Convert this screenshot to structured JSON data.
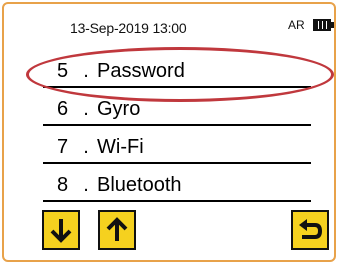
{
  "status": {
    "datetime": "13-Sep-2019  13:00",
    "mode_label": "AR",
    "battery_icon": "battery-icon"
  },
  "menu": {
    "items": [
      {
        "number": "5",
        "label": "Password",
        "highlighted": true
      },
      {
        "number": "6",
        "label": "Gyro"
      },
      {
        "number": "7",
        "label": "Wi-Fi"
      },
      {
        "number": "8",
        "label": "Bluetooth"
      }
    ],
    "separator": "."
  },
  "buttons": {
    "down": {
      "icon": "arrow-down-icon"
    },
    "up": {
      "icon": "arrow-up-icon"
    },
    "back": {
      "icon": "return-icon"
    }
  },
  "colors": {
    "button_fill": "#f5d11f",
    "highlight_oval": "#c0383d",
    "frame_border": "#e8a24a"
  }
}
